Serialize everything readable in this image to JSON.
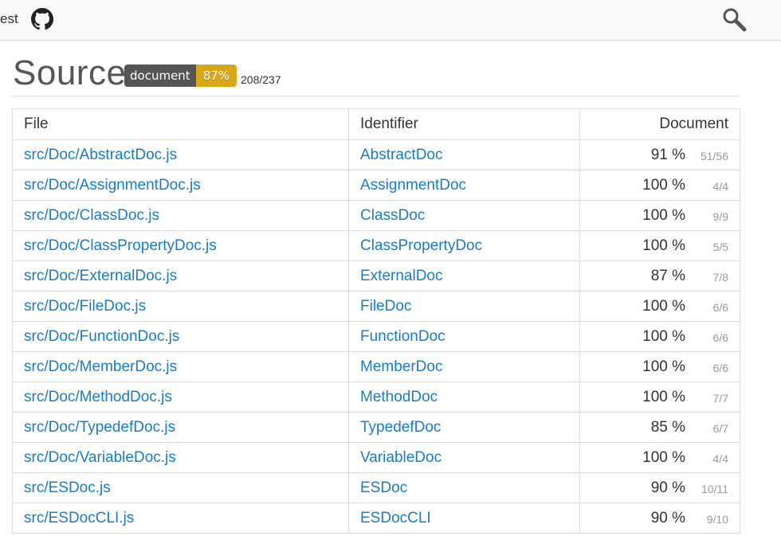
{
  "topbar": {
    "nav_link": "est",
    "github_icon": "github-icon",
    "search_icon": "search-icon"
  },
  "header": {
    "title": "Source",
    "badge_label": "document",
    "badge_value": "87%",
    "badge_color": "#d9a81a",
    "count": "208/237"
  },
  "table": {
    "columns": [
      "File",
      "Identifier",
      "Document"
    ],
    "rows": [
      {
        "file": "src/Doc/AbstractDoc.js",
        "identifier": "AbstractDoc",
        "percent": "91 %",
        "ratio": "51/56"
      },
      {
        "file": "src/Doc/AssignmentDoc.js",
        "identifier": "AssignmentDoc",
        "percent": "100 %",
        "ratio": "4/4"
      },
      {
        "file": "src/Doc/ClassDoc.js",
        "identifier": "ClassDoc",
        "percent": "100 %",
        "ratio": "9/9"
      },
      {
        "file": "src/Doc/ClassPropertyDoc.js",
        "identifier": "ClassPropertyDoc",
        "percent": "100 %",
        "ratio": "5/5"
      },
      {
        "file": "src/Doc/ExternalDoc.js",
        "identifier": "ExternalDoc",
        "percent": "87 %",
        "ratio": "7/8"
      },
      {
        "file": "src/Doc/FileDoc.js",
        "identifier": "FileDoc",
        "percent": "100 %",
        "ratio": "6/6"
      },
      {
        "file": "src/Doc/FunctionDoc.js",
        "identifier": "FunctionDoc",
        "percent": "100 %",
        "ratio": "6/6"
      },
      {
        "file": "src/Doc/MemberDoc.js",
        "identifier": "MemberDoc",
        "percent": "100 %",
        "ratio": "6/6"
      },
      {
        "file": "src/Doc/MethodDoc.js",
        "identifier": "MethodDoc",
        "percent": "100 %",
        "ratio": "7/7"
      },
      {
        "file": "src/Doc/TypedefDoc.js",
        "identifier": "TypedefDoc",
        "percent": "85 %",
        "ratio": "6/7"
      },
      {
        "file": "src/Doc/VariableDoc.js",
        "identifier": "VariableDoc",
        "percent": "100 %",
        "ratio": "4/4"
      },
      {
        "file": "src/ESDoc.js",
        "identifier": "ESDoc",
        "percent": "90 %",
        "ratio": "10/11"
      },
      {
        "file": "src/ESDocCLI.js",
        "identifier": "ESDocCLI",
        "percent": "90 %",
        "ratio": "9/10"
      }
    ]
  },
  "colors": {
    "link": "#1a7bc9",
    "badge_label_bg": "#555555",
    "badge_value_bg": "#d9a81a"
  }
}
